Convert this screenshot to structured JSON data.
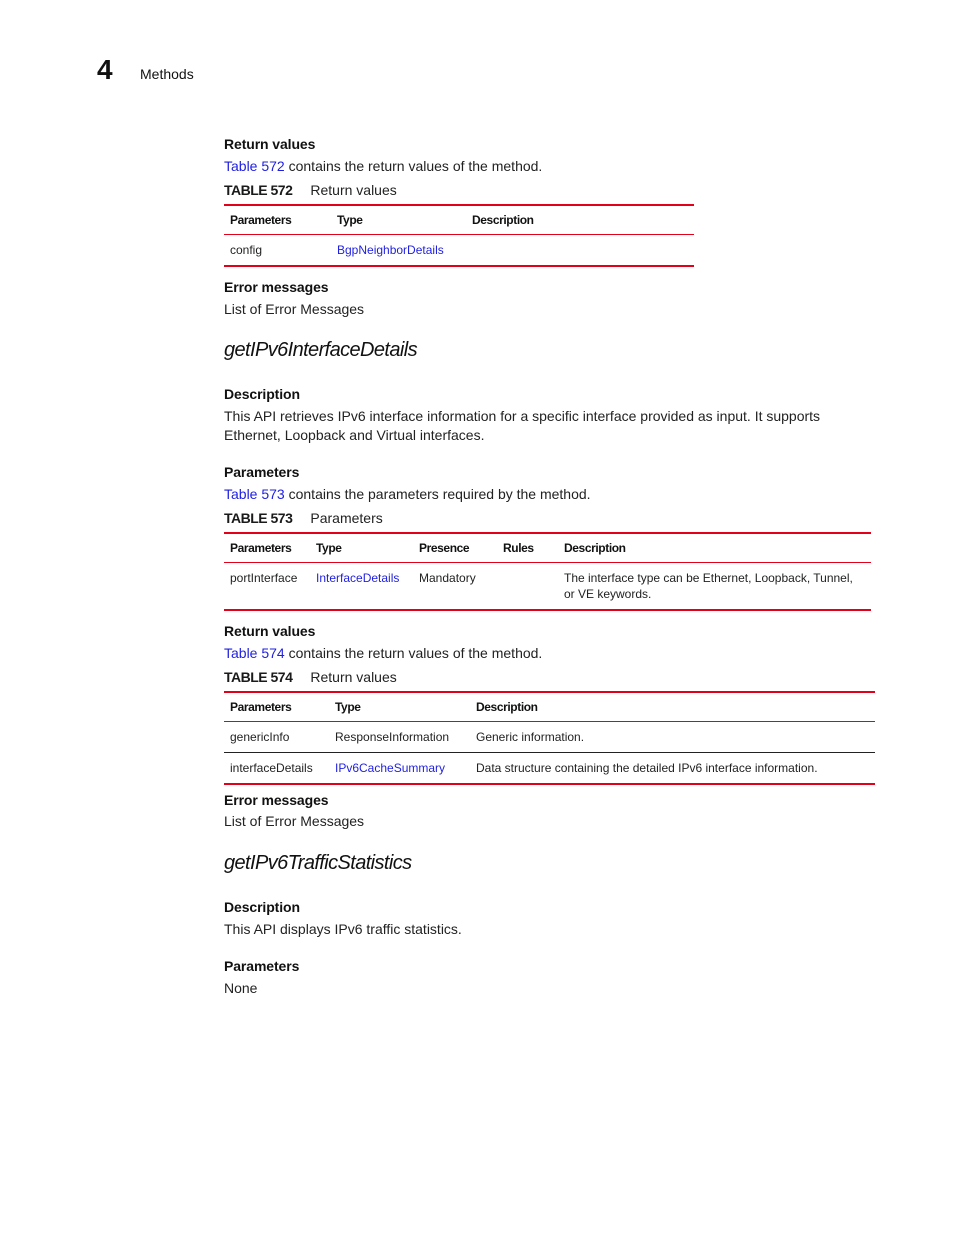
{
  "header": {
    "chapter_number": "4",
    "chapter_title": "Methods"
  },
  "section_prev": {
    "return_values_heading": "Return values",
    "return_values_link": "Table 572",
    "return_values_text": " contains the return values of the method.",
    "table_572": {
      "number": "TABLE 572",
      "caption": "Return values",
      "columns": [
        "Parameters",
        "Type",
        "Description"
      ],
      "rows": [
        {
          "parameter": "config",
          "type": "BgpNeighborDetails",
          "type_is_link": true,
          "description": ""
        }
      ]
    },
    "error_heading": "Error messages",
    "error_link": "List of Error Messages"
  },
  "method_1": {
    "title": "getIPv6InterfaceDetails",
    "description_heading": "Description",
    "description_text": "This API retrieves IPv6 interface information for a specific interface provided as input. It supports Ethernet, Loopback and Virtual interfaces.",
    "parameters_heading": "Parameters",
    "parameters_link": "Table 573",
    "parameters_text": " contains the parameters required by the method.",
    "table_573": {
      "number": "TABLE 573",
      "caption": "Parameters",
      "columns": [
        "Parameters",
        "Type",
        "Presence",
        "Rules",
        "Description"
      ],
      "rows": [
        {
          "parameter": "portInterface",
          "type": "InterfaceDetails",
          "type_is_link": true,
          "presence": "Mandatory",
          "rules": "",
          "description": "The interface type can be Ethernet, Loopback, Tunnel, or VE keywords."
        }
      ]
    },
    "return_values_heading": "Return values",
    "return_values_link": "Table 574",
    "return_values_text": " contains the return values of the method.",
    "table_574": {
      "number": "TABLE 574",
      "caption": "Return values",
      "columns": [
        "Parameters",
        "Type",
        "Description"
      ],
      "rows": [
        {
          "parameter": "genericInfo",
          "type": "ResponseInformation",
          "type_is_link": false,
          "description": "Generic information."
        },
        {
          "parameter": "interfaceDetails",
          "type": "IPv6CacheSummary",
          "type_is_link": true,
          "description": "Data structure containing the detailed IPv6 interface information."
        }
      ]
    },
    "error_heading": "Error messages",
    "error_link": "List of Error Messages"
  },
  "method_2": {
    "title": "getIPv6TrafficStatistics",
    "description_heading": "Description",
    "description_text": "This API displays IPv6 traffic statistics.",
    "parameters_heading": "Parameters",
    "parameters_text": "None"
  }
}
